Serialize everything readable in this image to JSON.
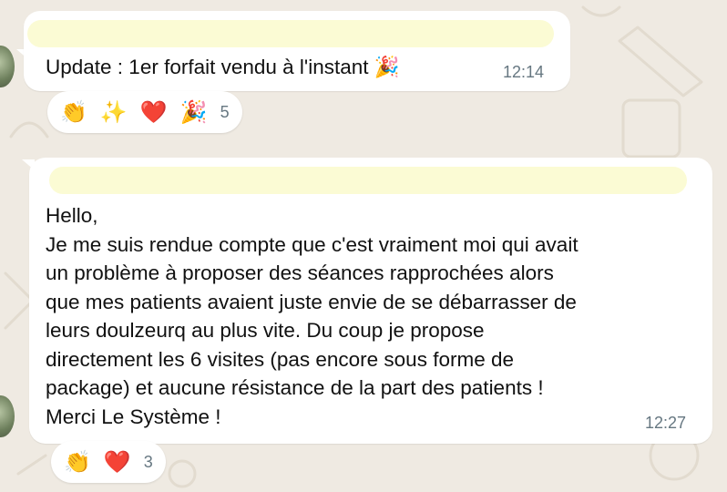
{
  "messages": [
    {
      "text": "Update : 1er forfait vendu à l'instant 🎉",
      "time": "12:14",
      "reactions": {
        "emojis": [
          "👏",
          "✨",
          "❤️",
          "🎉"
        ],
        "count": "5"
      }
    },
    {
      "text": "Hello,\nJe me suis rendue compte que c'est vraiment moi qui avait\nun problème à proposer des séances rapprochées alors\nque mes patients avaient juste envie de se débarrasser de\nleurs doulzeurq au plus vite. Du coup je propose\ndirectement les 6 visites (pas encore sous forme de\npackage) et aucune résistance de la part des patients !\nMerci Le Système !",
      "time": "12:27",
      "reactions": {
        "emojis": [
          "👏",
          "❤️"
        ],
        "count": "3"
      }
    }
  ],
  "colors": {
    "background": "#efeae2",
    "bubble": "#ffffff",
    "redacted_name": "#fbfbd4",
    "time": "#667781"
  }
}
